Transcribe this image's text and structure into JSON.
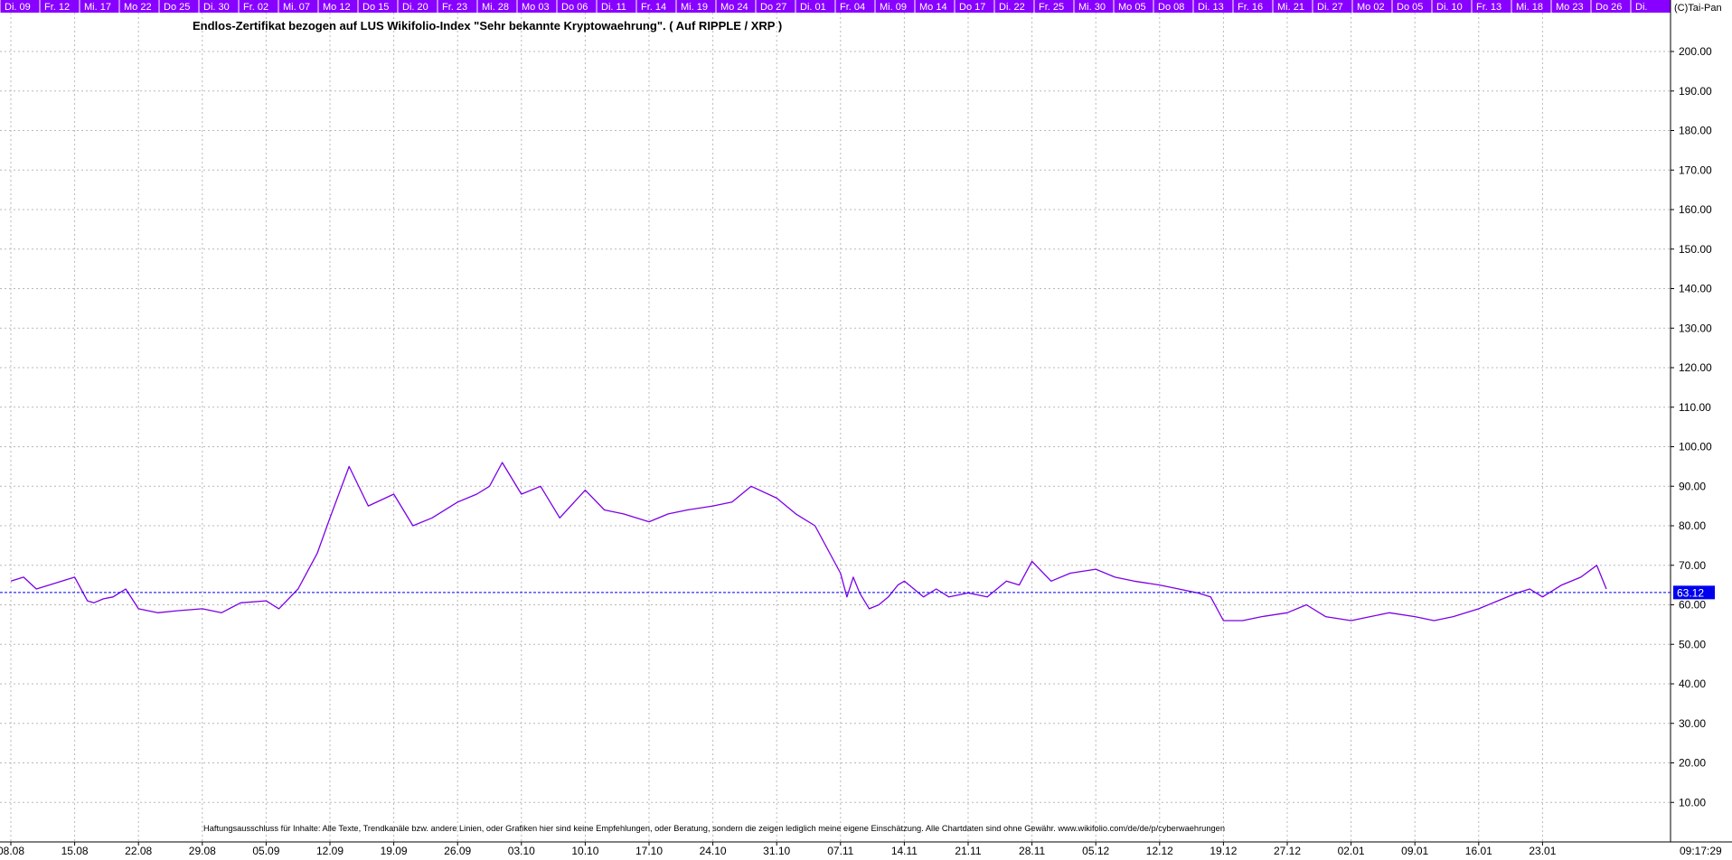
{
  "chart_data": {
    "type": "line",
    "title": "Endlos-Zertifikat bezogen auf LUS Wikifolio-Index \"Sehr bekannte Kryptowaehrung\". ( Auf RIPPLE / XRP )",
    "copyright": "(C)Tai-Pan",
    "disclaimer": "Haftungsausschluss für Inhalte: Alle Texte, Trendkanäle bzw. andere Linien, oder Grafiken hier sind keine Empfehlungen, oder Beratung, sondern die zeigen lediglich meine eigene Einschätzung. Alle Chartdaten sind ohne Gewähr. www.wikifolio.com/de/de/p/cyberwaehrungen",
    "time_label": "09:17:29",
    "ylim": [
      0,
      210
    ],
    "yticks": [
      10,
      20,
      30,
      40,
      50,
      60,
      70,
      80,
      90,
      100,
      110,
      120,
      130,
      140,
      150,
      160,
      170,
      180,
      190,
      200
    ],
    "ytick_labels": [
      "10.00",
      "20.00",
      "30.00",
      "40.00",
      "50.00",
      "60.00",
      "70.00",
      "80.00",
      "90.00",
      "100.00",
      "110.00",
      "120.00",
      "130.00",
      "140.00",
      "150.00",
      "160.00",
      "170.00",
      "180.00",
      "190.00",
      "200.00"
    ],
    "x_bottom_labels": [
      "08.08",
      "15.08",
      "22.08",
      "29.08",
      "05.09",
      "12.09",
      "19.09",
      "26.09",
      "03.10",
      "10.10",
      "17.10",
      "24.10",
      "31.10",
      "07.11",
      "14.11",
      "21.11",
      "28.11",
      "05.12",
      "12.12",
      "19.12",
      "27.12",
      "02.01",
      "09.01",
      "16.01",
      "23.01"
    ],
    "x_top_labels": [
      "Di. 09",
      "Fr. 12",
      "Mi. 17",
      "Mo 22",
      "Do 25",
      "Di. 30",
      "Fr. 02",
      "Mi. 07",
      "Mo 12",
      "Do 15",
      "Di. 20",
      "Fr. 23",
      "Mi. 28",
      "Mo 03",
      "Do 06",
      "Di. 11",
      "Fr. 14",
      "Mi. 19",
      "Mo 24",
      "Do 27",
      "Di. 01",
      "Fr. 04",
      "Mi. 09",
      "Mo 14",
      "Do 17",
      "Di. 22",
      "Fr. 25",
      "Mi. 30",
      "Mo 05",
      "Do 08",
      "Di. 13",
      "Fr. 16",
      "Mi. 21",
      "Di. 27",
      "Mo 02",
      "Do 05",
      "Di. 10",
      "Fr. 13",
      "Mi. 18",
      "Mo 23",
      "Do 26",
      "Di."
    ],
    "last_value": 63.12,
    "last_value_label": "63.12",
    "series": [
      {
        "color": "#7b00e6",
        "x": [
          0,
          0.2,
          0.4,
          0.6,
          0.8,
          1,
          1.2,
          1.3,
          1.45,
          1.6,
          1.8,
          2,
          2.3,
          2.6,
          3,
          3.3,
          3.6,
          4,
          4.2,
          4.5,
          4.8,
          5,
          5.3,
          5.6,
          6,
          6.3,
          6.6,
          7,
          7.3,
          7.5,
          7.7,
          7.85,
          8,
          8.3,
          8.6,
          9,
          9.3,
          9.6,
          10,
          10.3,
          10.6,
          11,
          11.3,
          11.6,
          12,
          12.3,
          12.6,
          13,
          13.1,
          13.2,
          13.3,
          13.45,
          13.6,
          13.75,
          13.9,
          14,
          14.15,
          14.3,
          14.5,
          14.7,
          15,
          15.3,
          15.6,
          15.8,
          16,
          16.3,
          16.6,
          17,
          17.3,
          17.6,
          18,
          18.3,
          18.6,
          18.8,
          19,
          19.3,
          19.6,
          20,
          20.3,
          20.6,
          21,
          21.3,
          21.6,
          22,
          22.3,
          22.6,
          23,
          23.3,
          23.6,
          23.8,
          24,
          24.3,
          24.6,
          24.85,
          25
        ],
        "values": [
          66,
          67,
          64,
          65,
          66,
          67,
          61,
          60.5,
          61.5,
          62,
          64,
          59,
          58,
          58.5,
          59,
          58,
          60.5,
          61,
          59,
          64,
          73,
          82,
          95,
          85,
          88,
          80,
          82,
          86,
          88,
          90,
          96,
          92,
          88,
          90,
          82,
          89,
          84,
          83,
          81,
          83,
          84,
          85,
          86,
          90,
          87,
          83,
          80,
          68,
          62,
          67,
          63,
          59,
          60,
          62,
          65,
          66,
          64,
          62,
          64,
          62,
          63,
          62,
          66,
          65,
          71,
          66,
          68,
          69,
          67,
          66,
          65,
          64,
          63,
          62,
          56,
          56,
          57,
          58,
          60,
          57,
          56,
          57,
          58,
          57,
          56,
          57,
          59,
          61,
          63,
          64,
          62,
          65,
          67,
          70,
          64
        ]
      }
    ]
  }
}
